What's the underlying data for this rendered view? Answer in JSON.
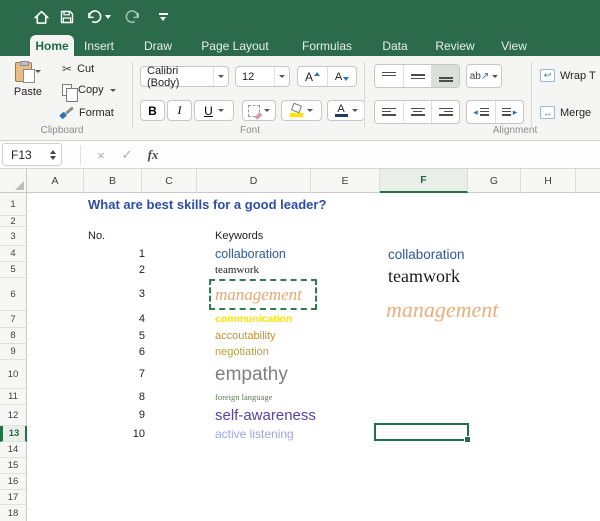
{
  "quick_access": {
    "home_icon": "home",
    "save_icon": "save",
    "undo_icon": "undo",
    "redo_icon": "redo",
    "customize_icon": "customize-quick-access"
  },
  "tabs": {
    "items": [
      {
        "label": "Home",
        "active": true
      },
      {
        "label": "Insert",
        "active": false
      },
      {
        "label": "Draw",
        "active": false
      },
      {
        "label": "Page Layout",
        "active": false
      },
      {
        "label": "Formulas",
        "active": false
      },
      {
        "label": "Data",
        "active": false
      },
      {
        "label": "Review",
        "active": false
      },
      {
        "label": "View",
        "active": false
      }
    ]
  },
  "ribbon": {
    "clipboard": {
      "label": "Clipboard",
      "paste": "Paste",
      "cut": "Cut",
      "copy": "Copy",
      "format": "Format"
    },
    "font": {
      "label": "Font",
      "font_name": "Calibri (Body)",
      "font_size": "12",
      "bold": "B",
      "italic": "I",
      "underline": "U",
      "grow": "A",
      "shrink": "A"
    },
    "alignment": {
      "label": "Alignment",
      "orientation": "ab",
      "wrap": "Wrap T",
      "merge": "Merge"
    }
  },
  "formula_bar": {
    "name_box": "F13",
    "cancel": "×",
    "enter": "✓",
    "fx_label": "fx",
    "formula_value": ""
  },
  "sheet": {
    "column_headers": [
      "A",
      "B",
      "C",
      "D",
      "E",
      "F",
      "G",
      "H"
    ],
    "selected_column": "F",
    "row_headers": [
      "1",
      "2",
      "3",
      "4",
      "5",
      "6",
      "7",
      "8",
      "9",
      "10",
      "11",
      "12",
      "13",
      "14",
      "15",
      "16",
      "17",
      "18"
    ],
    "selected_row": "13",
    "active_cell": "F13",
    "title": "What are best skills for a good leader?",
    "no_header": "No.",
    "keywords_header": "Keywords",
    "items": [
      {
        "n": "1",
        "keyword": "collaboration",
        "color": "#2F5597"
      },
      {
        "n": "2",
        "keyword": "teamwork",
        "color": "#1B1B1B"
      },
      {
        "n": "3",
        "keyword": "management",
        "color": "#E8A771"
      },
      {
        "n": "4",
        "keyword": "communication",
        "color": "#FFE200"
      },
      {
        "n": "5",
        "keyword": "accoutability",
        "color": "#C2902E"
      },
      {
        "n": "6",
        "keyword": "negotiation",
        "color": "#B0A23C"
      },
      {
        "n": "7",
        "keyword": "empathy",
        "color": "#7F7F7F"
      },
      {
        "n": "8",
        "keyword": "foreign language",
        "color": "#5E7B55"
      },
      {
        "n": "9",
        "keyword": "self-awareness",
        "color": "#5A3FA5"
      },
      {
        "n": "10",
        "keyword": "active listening",
        "color": "#9FA4DF"
      }
    ],
    "preview": [
      {
        "text": "collaboration",
        "color": "#2F5597"
      },
      {
        "text": "teamwork",
        "color": "#1B1B1B"
      },
      {
        "text": "management",
        "color": "#ECAE79"
      }
    ]
  },
  "colors": {
    "accent_green": "#217346",
    "titlebar_green": "#2B6A4B",
    "title_text": "#2F4DA5",
    "highlight_yellow": "#FFE200",
    "font_color_swatch": "#1F3864"
  }
}
